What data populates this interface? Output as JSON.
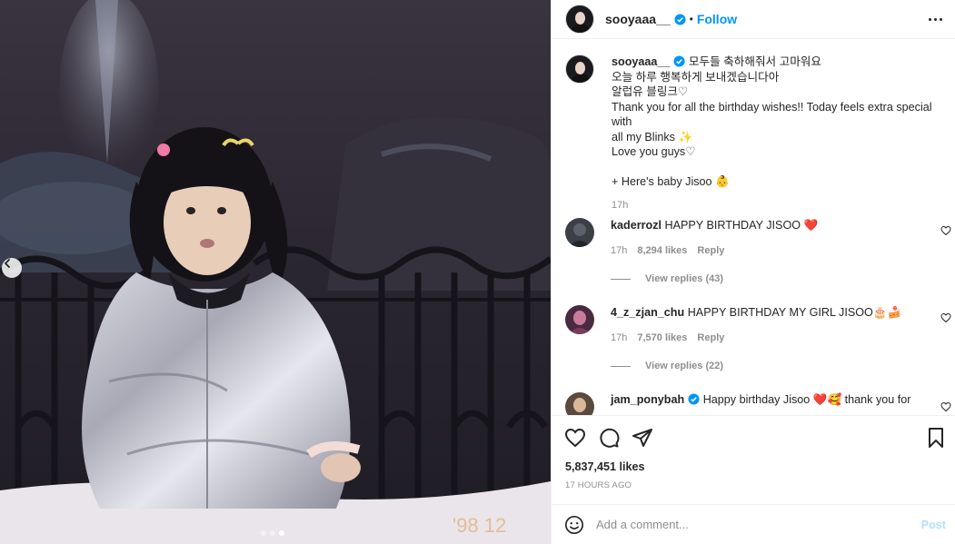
{
  "colors": {
    "accent": "#0095f6",
    "muted": "#8e8e8e",
    "text": "#262626",
    "post_disabled": "#b2dffc",
    "heart_red": "#ed4956"
  },
  "header": {
    "username": "sooyaaa__",
    "separator": "•",
    "follow_label": "Follow"
  },
  "caption": {
    "username": "sooyaaa__",
    "lines": [
      "모두들 축하해줘서 고마워요",
      "오늘 하루 행복하게 보내겠습니다아",
      "알럽유 블링크♡",
      "Thank you for all the birthday wishes!! Today feels extra special with",
      "all my Blinks ✨",
      "Love you guys♡",
      "",
      "+ Here's baby Jisoo 👶"
    ],
    "time": "17h"
  },
  "comments": [
    {
      "username": "kaderrozl",
      "text": "HAPPY BIRTHDAY JISOO ❤️",
      "time": "17h",
      "likes": "8,294 likes",
      "reply_label": "Reply",
      "view_replies": "View replies (43)"
    },
    {
      "username": "4_z_zjan_chu",
      "text": "HAPPY BIRTHDAY MY GIRL JISOO🎂🍰",
      "time": "17h",
      "likes": "7,570 likes",
      "reply_label": "Reply",
      "view_replies": "View replies (22)"
    },
    {
      "username": "jam_ponybah",
      "text": "Happy birthday Jisoo ❤️🥰 thank you for"
    }
  ],
  "post_meta": {
    "likes": "5,837,451 likes",
    "posted_ago": "17 HOURS AGO"
  },
  "comment_box": {
    "placeholder": "Add a comment...",
    "post_label": "Post"
  },
  "carousel": {
    "slides": 3,
    "active_index": 2
  },
  "photo": {
    "date_stamp": "'98 12"
  }
}
